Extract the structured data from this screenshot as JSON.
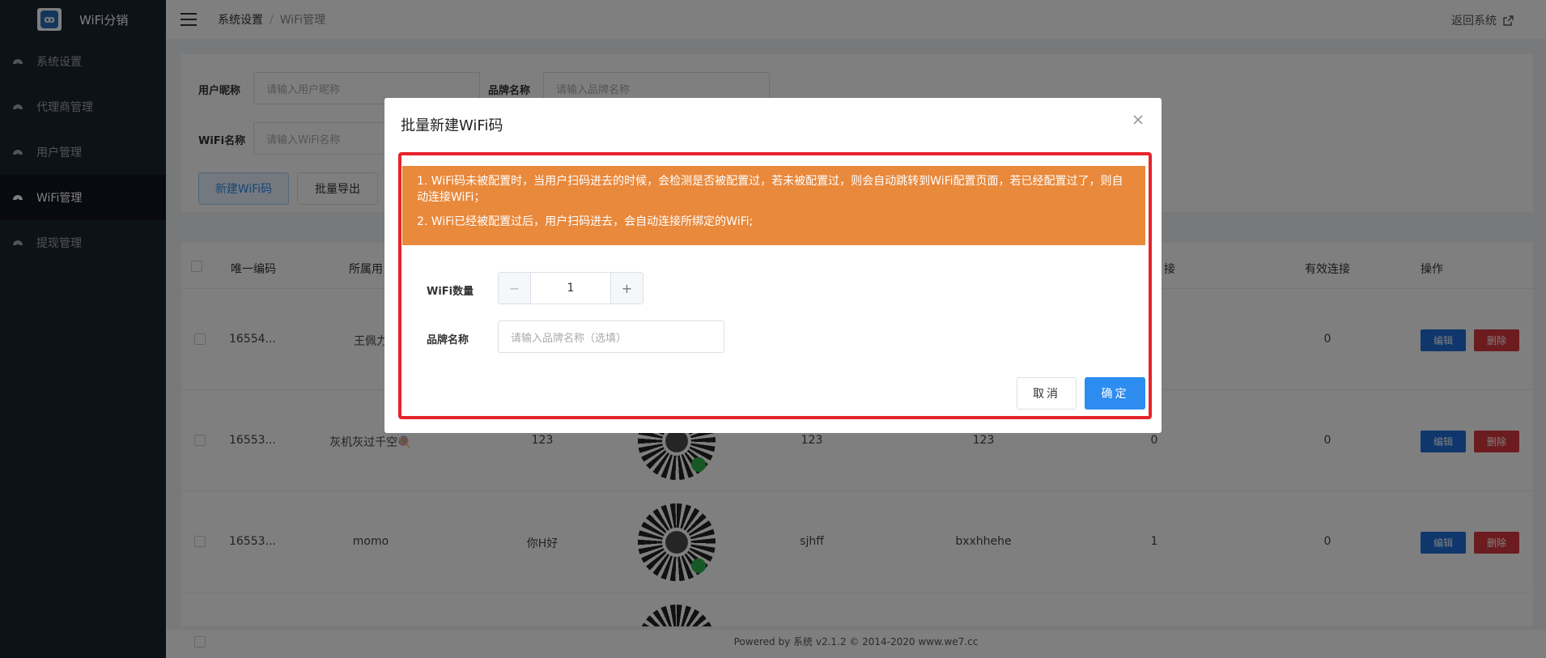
{
  "sidebar": {
    "logo_text": "WiFi分销",
    "logo_mark": "ꝏ",
    "items": [
      {
        "label": "系统设置",
        "icon": "dashboard-icon",
        "active": false
      },
      {
        "label": "代理商管理",
        "icon": "dashboard-icon",
        "active": false
      },
      {
        "label": "用户管理",
        "icon": "dashboard-icon",
        "active": false
      },
      {
        "label": "WiFi管理",
        "icon": "dashboard-icon",
        "active": true
      },
      {
        "label": "提现管理",
        "icon": "dashboard-icon",
        "active": false
      }
    ]
  },
  "header": {
    "breadcrumb_root": "系统设置",
    "breadcrumb_sep": "/",
    "breadcrumb_current": "WiFi管理",
    "back_label": "返回系统"
  },
  "filter": {
    "nickname_label": "用户昵称",
    "nickname_placeholder": "请输入用户昵称",
    "brand_label": "品牌名称",
    "brand_placeholder": "请输入品牌名称",
    "wifi_label": "WiFi名称",
    "wifi_placeholder": "请输入WiFi名称",
    "new_button": "新建WiFi码",
    "export_button": "批量导出"
  },
  "table": {
    "headers": {
      "code": "唯一编码",
      "owner": "所属用",
      "connect": "接",
      "valid": "有效连接",
      "ops": "操作"
    },
    "rows": [
      {
        "code": "16554...",
        "owner": "王佩力",
        "col3": "",
        "col5": "",
        "col6": "",
        "col7": "",
        "valid": "0"
      },
      {
        "code": "16553...",
        "owner": "灰机灰过千空🍭",
        "col3": "123",
        "col5": "123",
        "col6": "123",
        "col7": "0",
        "valid": "0"
      },
      {
        "code": "16553...",
        "owner": "momo",
        "col3": "你H好",
        "col5": "sjhff",
        "col6": "bxxhhehe",
        "col7": "1",
        "valid": "0"
      }
    ],
    "edit_label": "编辑",
    "delete_label": "删除"
  },
  "footer": {
    "text": "Powered by 系统 v2.1.2 © 2014-2020 www.we7.cc"
  },
  "modal": {
    "title": "批量新建WiFi码",
    "notice_1": "1. WiFi码未被配置时，当用户扫码进去的时候，会检测是否被配置过，若未被配置过，则会自动跳转到WiFi配置页面，若已经配置过了，则自动连接WiFi；",
    "notice_2": "2. WiFi已经被配置过后，用户扫码进去，会自动连接所绑定的WiFi;",
    "count_label": "WiFi数量",
    "count_value": "1",
    "minus": "−",
    "plus": "+",
    "brand_label": "品牌名称",
    "brand_placeholder": "请输入品牌名称（选填）",
    "cancel_label": "取消",
    "ok_label": "确定"
  },
  "colors": {
    "sidebar_bg": "#1b2231",
    "primary": "#2d8cf0",
    "alert_bg": "#e9893c",
    "highlight": "#e6242b",
    "danger": "#d9383d"
  }
}
